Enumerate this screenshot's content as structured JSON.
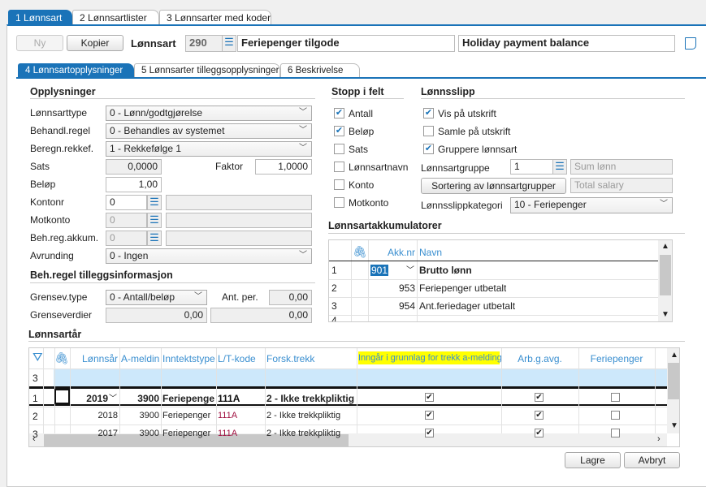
{
  "tabs": [
    {
      "num": "1",
      "label": "Lønnsart"
    },
    {
      "num": "2",
      "label": "Lønnsartlister"
    },
    {
      "num": "3",
      "label": "Lønnsarter med koder"
    }
  ],
  "toolbar": {
    "new": "Ny",
    "copy": "Kopier",
    "lonnsart_label": "Lønnsart",
    "lonnsart_nr": "290",
    "name": "Feriepenger  tilgode",
    "name_en": "Holiday payment balance"
  },
  "subtabs": [
    {
      "num": "4",
      "label": "Lønnsartopplysninger"
    },
    {
      "num": "5",
      "label": "Lønnsarter tilleggsopplysninger"
    },
    {
      "num": "6",
      "label": "Beskrivelse"
    }
  ],
  "opplysninger": {
    "heading": "Opplysninger",
    "lonnsarttype_label": "Lønnsarttype",
    "lonnsarttype": "0 - Lønn/godtgjørelse",
    "behandl_label": "Behandl.regel",
    "behandl": "0 - Behandles av systemet",
    "beregn_label": "Beregn.rekkef.",
    "beregn": "1 - Rekkefølge 1",
    "sats_label": "Sats",
    "sats": "0,0000",
    "faktor_label": "Faktor",
    "faktor": "1,0000",
    "belop_label": "Beløp",
    "belop": "1,00",
    "kontonr_label": "Kontonr",
    "kontonr": "0",
    "motkonto_label": "Motkonto",
    "motkonto": "0",
    "behreg_label": "Beh.reg.akkum.",
    "behreg": "0",
    "avrunding_label": "Avrunding",
    "avrunding": "0 - Ingen"
  },
  "tillegg": {
    "heading": "Beh.regel tilleggsinformasjon",
    "grensev_label": "Grensev.type",
    "grensev": "0 - Antall/beløp",
    "antper_label": "Ant. per.",
    "antper": "0,00",
    "grenseverdier_label": "Grenseverdier",
    "gv1": "0,00",
    "gv2": "0,00"
  },
  "stopp": {
    "heading": "Stopp i felt",
    "items": [
      {
        "label": "Antall",
        "checked": true
      },
      {
        "label": "Beløp",
        "checked": true
      },
      {
        "label": "Sats",
        "checked": false
      },
      {
        "label": "Lønnsartnavn",
        "checked": false
      },
      {
        "label": "Konto",
        "checked": false
      },
      {
        "label": "Motkonto",
        "checked": false
      }
    ]
  },
  "lonnsslipp": {
    "heading": "Lønnsslipp",
    "items": [
      {
        "label": "Vis på utskrift",
        "checked": true
      },
      {
        "label": "Samle på utskrift",
        "checked": false
      },
      {
        "label": "Gruppere lønnsart",
        "checked": true
      }
    ],
    "gruppe_label": "Lønnsartgruppe",
    "gruppe": "1",
    "gruppe_name": "Sum lønn",
    "sort_button": "Sortering av lønnsartgrupper",
    "gruppe_name_en": "Total salary",
    "kategori_label": "Lønnsslippkategori",
    "kategori": "10 - Feriepenger"
  },
  "akk": {
    "heading": "Lønnsartakkumulatorer",
    "columns": [
      "Akk.nr",
      "Navn"
    ],
    "rows": [
      {
        "n": "1",
        "nr": "901",
        "navn": "Brutto lønn"
      },
      {
        "n": "2",
        "nr": "953",
        "navn": "Feriepenger utbetalt"
      },
      {
        "n": "3",
        "nr": "954",
        "navn": "Ant.feriedager utbetalt"
      }
    ]
  },
  "aar": {
    "heading": "Lønnsartår",
    "columns": [
      "Lønnsår",
      "A-meldin",
      "Inntektstype",
      "L/T-kode",
      "Forsk.trekk",
      "Inngår i grunnlag for trekk a-melding",
      "Arb.g.avg.",
      "Feriepenger"
    ],
    "new_row": "3",
    "highlight_color": "#ffff00",
    "rows": [
      {
        "n": "1",
        "year": "2019",
        "amelding": "3900",
        "type": "Feriepenge",
        "lt": "111A",
        "forsk": "2 - Ikke trekkpliktig",
        "inngar": true,
        "arbg": true,
        "ferie": false
      },
      {
        "n": "2",
        "year": "2018",
        "amelding": "3900",
        "type": "Feriepenger",
        "lt": "111A",
        "forsk": "2 - Ikke trekkpliktig",
        "inngar": true,
        "arbg": true,
        "ferie": false
      },
      {
        "n": "3",
        "year": "2017",
        "amelding": "3900",
        "type": "Feriepenger",
        "lt": "111A",
        "forsk": "2 - Ikke trekkpliktig",
        "inngar": true,
        "arbg": true,
        "ferie": false
      }
    ]
  },
  "footer": {
    "save": "Lagre",
    "cancel": "Avbryt"
  }
}
